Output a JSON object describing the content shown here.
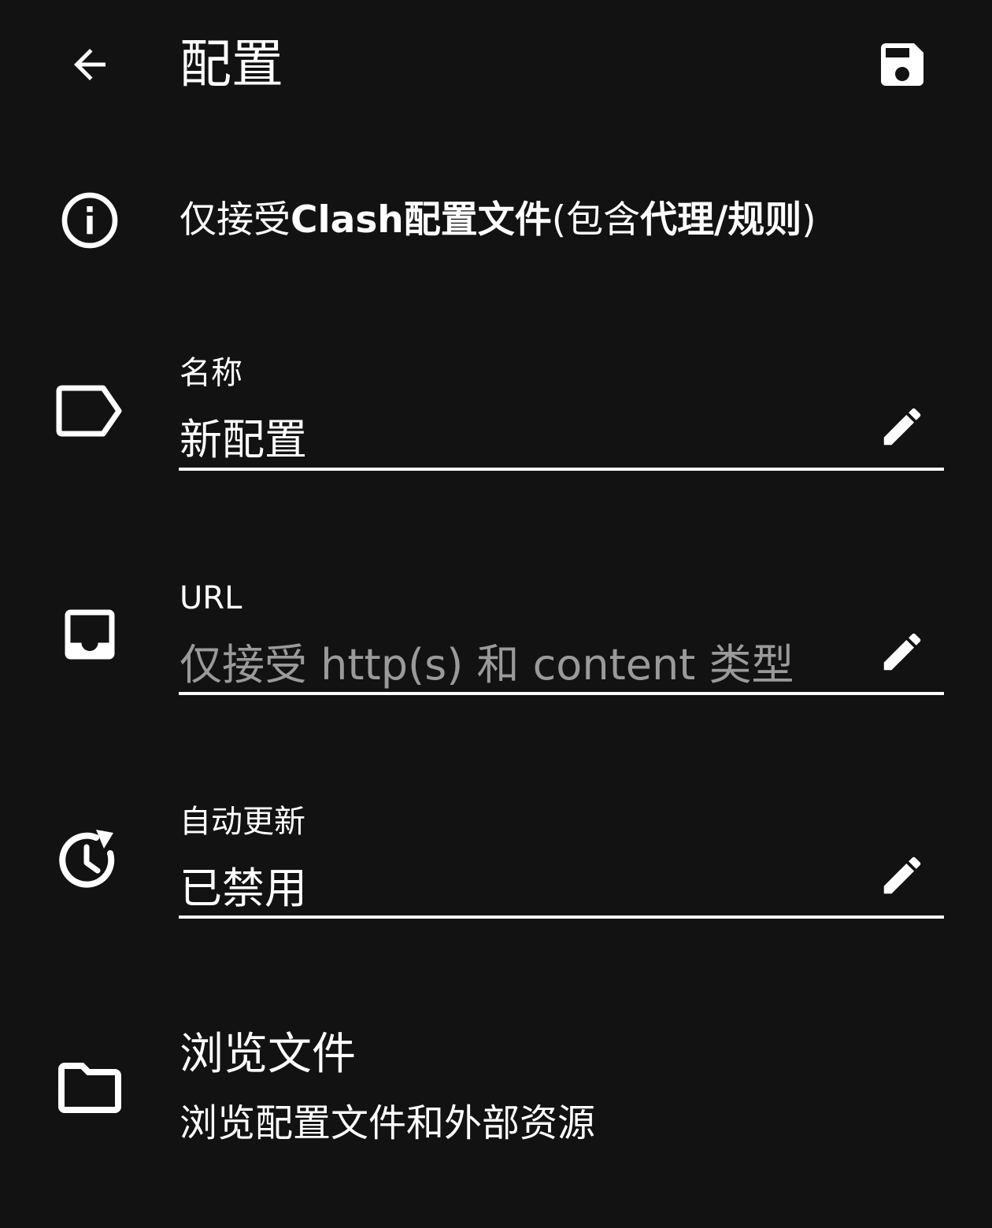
{
  "header": {
    "title": "配置",
    "back_icon": "arrow-left-icon",
    "save_icon": "floppy-disk-icon"
  },
  "info": {
    "icon": "info-circle-icon",
    "text_parts": [
      "仅接受",
      "Clash",
      "配置文件",
      "(包含",
      "代理",
      "/",
      "规则",
      ")"
    ]
  },
  "fields": {
    "name": {
      "icon": "label-tag-icon",
      "label": "名称",
      "value": "新配置"
    },
    "url": {
      "icon": "inbox-tray-icon",
      "label": "URL",
      "placeholder": "仅接受 http(s) 和 content 类型"
    },
    "auto_update": {
      "icon": "clock-refresh-icon",
      "label": "自动更新",
      "value": "已禁用"
    }
  },
  "browse": {
    "icon": "folder-icon",
    "title": "浏览文件",
    "subtitle": "浏览配置文件和外部资源"
  },
  "colors": {
    "background": "#121212",
    "text": "#ffffff",
    "placeholder": "#9a9a9a"
  }
}
